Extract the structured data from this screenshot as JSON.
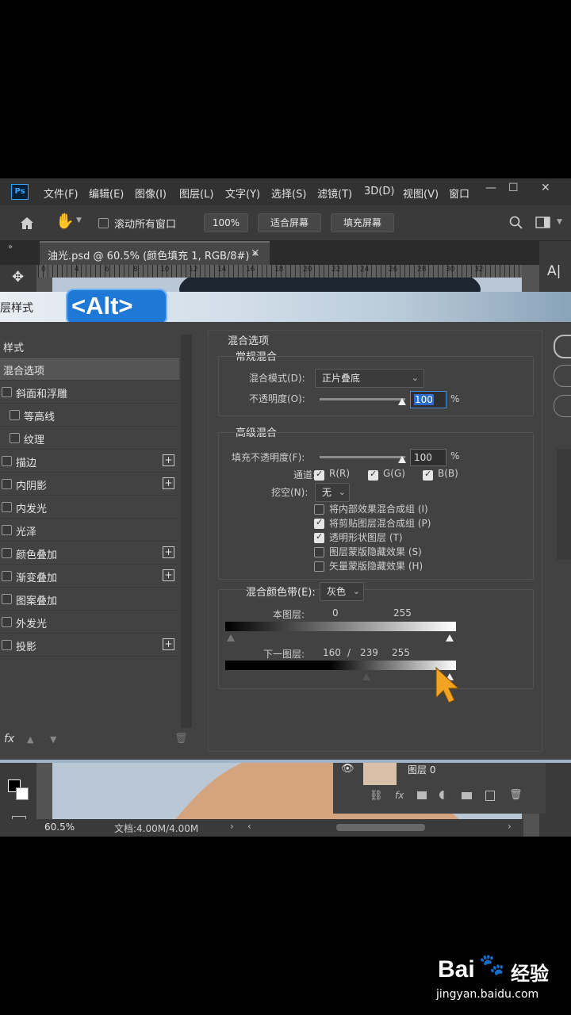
{
  "app": {
    "logo": "Ps",
    "menus": [
      "文件(F)",
      "编辑(E)",
      "图像(I)",
      "图层(L)",
      "文字(Y)",
      "选择(S)",
      "滤镜(T)",
      "3D(D)",
      "视图(V)",
      "窗口"
    ],
    "window_controls": [
      "—",
      "☐",
      "✕"
    ]
  },
  "options_bar": {
    "home_icon": "home-icon",
    "hand_icon": "hand-icon",
    "scroll_all_label": "滚动所有窗口",
    "zoom_label": "100%",
    "fit_screen_label": "适合屏幕",
    "fill_screen_label": "填充屏幕"
  },
  "document_tab": {
    "title": "油光.psd @ 60.5% (颜色填充 1, RGB/8#) *",
    "close": "×"
  },
  "ruler": {
    "numbers": [
      "0",
      "4",
      "6",
      "8",
      "10",
      "12",
      "14",
      "16",
      "18",
      "20",
      "22",
      "24",
      "26",
      "28",
      "30",
      "32"
    ]
  },
  "dialog": {
    "title": "层样式",
    "alt_badge": "<Alt>",
    "left_items": [
      {
        "label": "样式",
        "checkbox": false,
        "plus": false,
        "indent": false
      },
      {
        "label": "混合选项",
        "checkbox": false,
        "plus": false,
        "indent": false,
        "selected": true
      },
      {
        "label": "斜面和浮雕",
        "checkbox": true,
        "plus": false,
        "indent": false
      },
      {
        "label": "等高线",
        "checkbox": true,
        "plus": false,
        "indent": true
      },
      {
        "label": "纹理",
        "checkbox": true,
        "plus": false,
        "indent": true
      },
      {
        "label": "描边",
        "checkbox": true,
        "plus": true,
        "indent": false
      },
      {
        "label": "内阴影",
        "checkbox": true,
        "plus": true,
        "indent": false
      },
      {
        "label": "内发光",
        "checkbox": true,
        "plus": false,
        "indent": false
      },
      {
        "label": "光泽",
        "checkbox": true,
        "plus": false,
        "indent": false
      },
      {
        "label": "颜色叠加",
        "checkbox": true,
        "plus": true,
        "indent": false
      },
      {
        "label": "渐变叠加",
        "checkbox": true,
        "plus": true,
        "indent": false
      },
      {
        "label": "图案叠加",
        "checkbox": true,
        "plus": false,
        "indent": false
      },
      {
        "label": "外发光",
        "checkbox": true,
        "plus": false,
        "indent": false
      },
      {
        "label": "投影",
        "checkbox": true,
        "plus": true,
        "indent": false
      }
    ],
    "bottom_icons": [
      "fx",
      "▲",
      "▼",
      "🗑"
    ],
    "blend_options": {
      "section_title": "混合选项",
      "general_title": "常规混合",
      "blend_mode_label": "混合模式(D):",
      "blend_mode_value": "正片叠底",
      "opacity_label": "不透明度(O):",
      "opacity_value": "100",
      "opacity_level": 1.0,
      "percent": "%",
      "advanced_title": "高级混合",
      "fill_opacity_label": "填充不透明度(F):",
      "fill_opacity_value": "100",
      "fill_opacity_level": 1.0,
      "channels_label": "通道:",
      "channels": [
        {
          "label": "R(R)",
          "checked": true
        },
        {
          "label": "G(G)",
          "checked": true
        },
        {
          "label": "B(B)",
          "checked": true
        }
      ],
      "knockout_label": "挖空(N):",
      "knockout_value": "无",
      "options": [
        {
          "label": "将内部效果混合成组 (I)",
          "checked": false
        },
        {
          "label": "将剪贴图层混合成组 (P)",
          "checked": true
        },
        {
          "label": "透明形状图层 (T)",
          "checked": true
        },
        {
          "label": "图层蒙版隐藏效果 (S)",
          "checked": false
        },
        {
          "label": "矢量蒙版隐藏效果 (H)",
          "checked": false
        }
      ],
      "blend_if_label": "混合颜色带(E):",
      "blend_if_value": "灰色",
      "this_layer_label": "本图层:",
      "this_layer_low": "0",
      "this_layer_high": "255",
      "underlying_label": "下一图层:",
      "underlying_low": "160",
      "underlying_sep": "/",
      "underlying_mid": "239",
      "underlying_high": "255"
    }
  },
  "layers_panel": {
    "layer_name": "图层 0",
    "footer_icons": [
      "link-icon",
      "fx-icon",
      "mask-icon",
      "adjustment-icon",
      "folder-icon",
      "new-layer-icon",
      "trash-icon"
    ]
  },
  "status": {
    "zoom": "60.5%",
    "doc": "文档:4.00M/4.00M"
  },
  "watermark": {
    "brand": "Bai",
    "brand2": "经验",
    "url": "jingyan.baidu.com"
  }
}
